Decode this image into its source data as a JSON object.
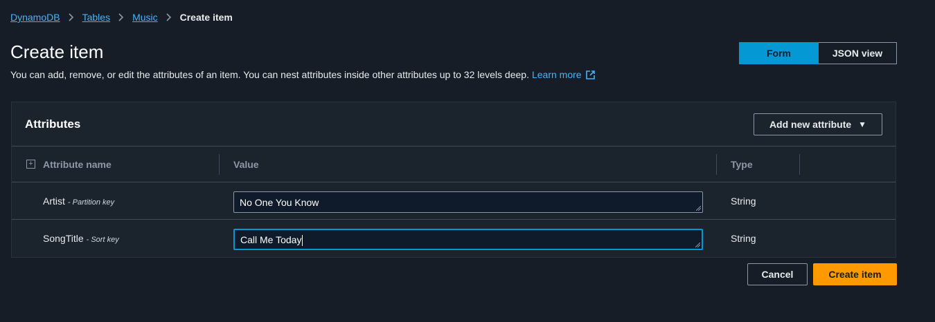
{
  "breadcrumb": {
    "items": [
      "DynamoDB",
      "Tables",
      "Music"
    ],
    "current": "Create item"
  },
  "page": {
    "title": "Create item",
    "description": "You can add, remove, or edit the attributes of an item. You can nest attributes inside other attributes up to 32 levels deep.",
    "learn_more": "Learn more"
  },
  "view_toggle": {
    "form": "Form",
    "json": "JSON view",
    "selected": "Form"
  },
  "panel": {
    "title": "Attributes",
    "add_button": "Add new attribute",
    "columns": {
      "name": "Attribute name",
      "value": "Value",
      "type": "Type"
    },
    "rows": [
      {
        "name": "Artist",
        "key": "- Partition key",
        "value": "No One You Know",
        "type": "String"
      },
      {
        "name": "SongTitle",
        "key": "- Sort key",
        "value": "Call Me Today",
        "type": "String"
      }
    ]
  },
  "footer": {
    "cancel": "Cancel",
    "create": "Create item"
  },
  "colors": {
    "background": "#161d26",
    "link": "#42b4ff",
    "selected_toggle": "#0498d4",
    "primary_button": "#ff9900"
  },
  "icons": [
    "chevron-right-icon",
    "external-link-icon",
    "expand-icon",
    "caret-down-icon",
    "resize-grip-icon"
  ]
}
